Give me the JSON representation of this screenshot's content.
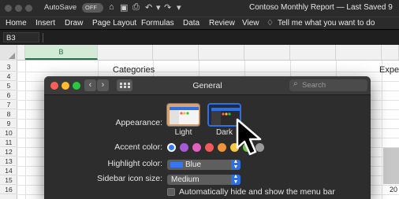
{
  "excel": {
    "autosave_label": "AutoSave",
    "autosave_state": "OFF",
    "doc_title": "Contoso Monthly Report — Last Saved 9",
    "tabs": [
      "Home",
      "Insert",
      "Draw",
      "Page Layout",
      "Formulas",
      "Data",
      "Review",
      "View"
    ],
    "tell_me": "Tell me what you want to do",
    "name_box": "B3",
    "selected_column": "B",
    "row_numbers": [
      "3",
      "4",
      "5",
      "6",
      "7",
      "8",
      "9",
      "10",
      "11",
      "12",
      "13",
      "14",
      "15",
      "16"
    ],
    "cell_categories": "Categories",
    "cell_expenses": "Exper",
    "cell_axis": "20"
  },
  "prefs": {
    "title": "General",
    "search_placeholder": "Search",
    "appearance_label": "Appearance:",
    "light_label": "Light",
    "dark_label": "Dark",
    "accent_label": "Accent color:",
    "accent_colors": [
      "#9a9a9a",
      "#a55bd6",
      "#e061c0",
      "#f15a5a",
      "#f0943a",
      "#f6c844",
      "#6cc24a"
    ],
    "highlight_label": "Highlight color:",
    "highlight_value": "Blue",
    "sidebar_label": "Sidebar icon size:",
    "sidebar_value": "Medium",
    "menubar_checkbox": "Automatically hide and show the menu bar"
  }
}
